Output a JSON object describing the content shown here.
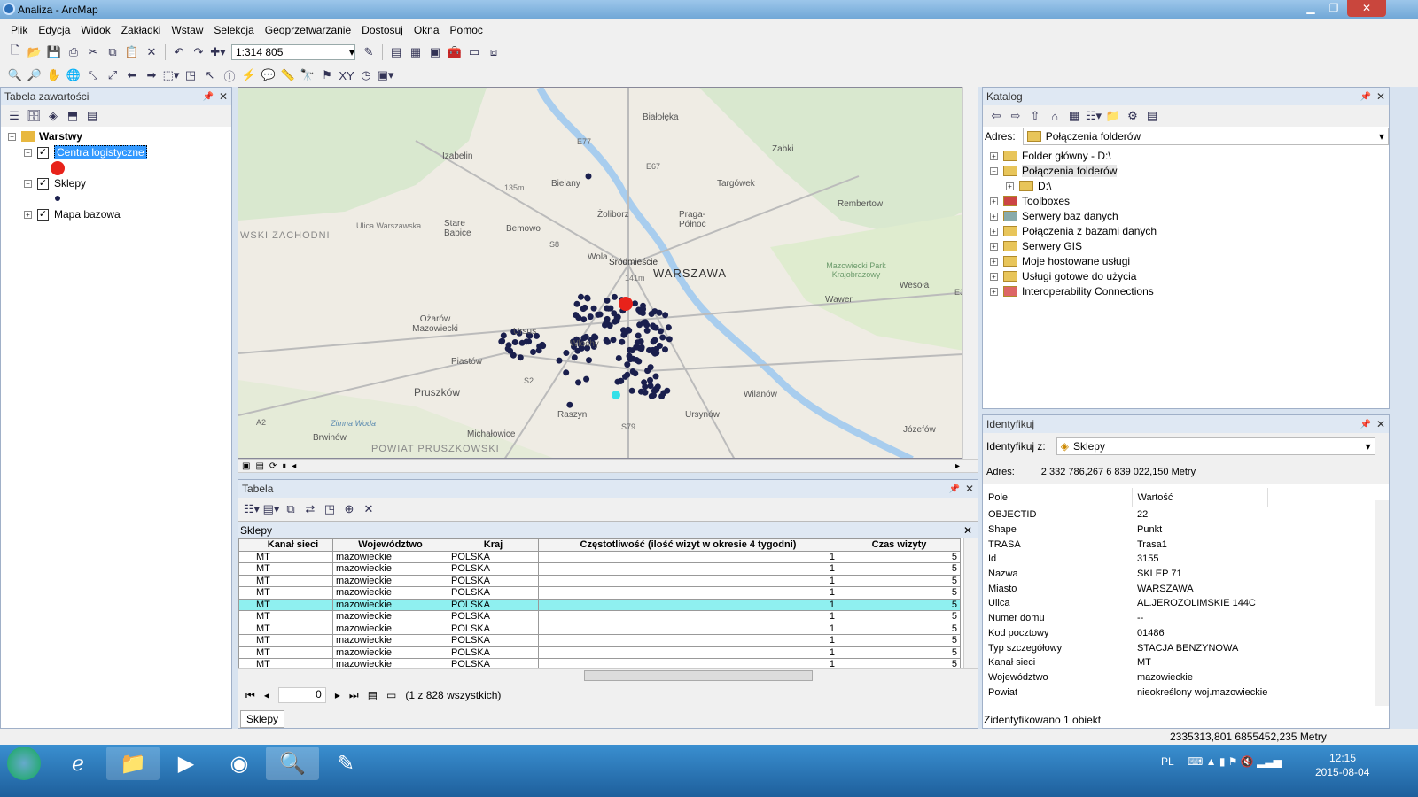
{
  "window": {
    "title": "Analiza - ArcMap"
  },
  "menu": [
    "Plik",
    "Edycja",
    "Widok",
    "Zakładki",
    "Wstaw",
    "Selekcja",
    "Geoprzetwarzanie",
    "Dostosuj",
    "Okna",
    "Pomoc"
  ],
  "toolbar": {
    "scale": "1:314 805"
  },
  "toc": {
    "title": "Tabela zawartości",
    "root": "Warstwy",
    "layers": [
      "Centra logistyczne",
      "Sklepy",
      "Mapa bazowa"
    ]
  },
  "map": {
    "places": [
      "Białołęka",
      "Izabelin",
      "Bielany",
      "Zabki",
      "Targówek",
      "Żoliborz",
      "Praga-Północ",
      "Rembertow",
      "Bemowo",
      "Stare Babice",
      "WSKI ZACHODNI",
      "Ulica Warszawska",
      "Wola",
      "Śródmieście",
      "WARSZAWA",
      "Mazowiecki Park Krajobrazowy",
      "Wesoła",
      "Ożarów Mazowiecki",
      "Ursus",
      "Włochy",
      "Wawer",
      "Piastów",
      "Pruszków",
      "Raszyn",
      "Wilanów",
      "Ursynów",
      "Michałowice",
      "Brwinów",
      "POWIAT PRUSZKOWSKI",
      "Józefów",
      "135m",
      "141m",
      "E77",
      "E30",
      "S8",
      "S79",
      "E67",
      "S2",
      "A2",
      "Zimna Woda"
    ],
    "colors": {
      "shop": "#1a1f4d",
      "center": "#e8221a",
      "selected": "#33e0e8"
    }
  },
  "catalog": {
    "title": "Katalog",
    "address_label": "Adres:",
    "address_value": "Połączenia folderów",
    "items": [
      "Folder główny - D:\\",
      "Połączenia folderów",
      "D:\\",
      "Toolboxes",
      "Serwery baz danych",
      "Połączenia z bazami danych",
      "Serwery GIS",
      "Moje hostowane usługi",
      "Usługi gotowe do użycia",
      "Interoperability Connections"
    ]
  },
  "identify": {
    "title": "Identyfikuj",
    "from_label": "Identyfikuj z:",
    "from_value": "Sklepy",
    "address_label": "Adres:",
    "address_value": "2 332 786,267  6 839 022,150 Metry",
    "col_field": "Pole",
    "col_value": "Wartość",
    "rows": [
      {
        "f": "OBJECTID",
        "v": "22"
      },
      {
        "f": "Shape",
        "v": "Punkt"
      },
      {
        "f": "TRASA",
        "v": "Trasa1"
      },
      {
        "f": "Id",
        "v": "3155"
      },
      {
        "f": "Nazwa",
        "v": "SKLEP 71"
      },
      {
        "f": "Miasto",
        "v": "WARSZAWA"
      },
      {
        "f": "Ulica",
        "v": "AL.JEROZOLIMSKIE 144C"
      },
      {
        "f": "Numer domu",
        "v": "--"
      },
      {
        "f": "Kod pocztowy",
        "v": "01486"
      },
      {
        "f": "Typ szczegółowy",
        "v": "STACJA BENZYNOWA"
      },
      {
        "f": "Kanał sieci",
        "v": "MT"
      },
      {
        "f": "Województwo",
        "v": "mazowieckie"
      },
      {
        "f": "Powiat",
        "v": "nieokreślony woj.mazowieckie"
      }
    ],
    "status": "Zidentyfikowano 1 obiekt"
  },
  "table": {
    "title": "Tabela",
    "layer": "Sklepy",
    "columns": [
      "Kanał sieci",
      "Województwo",
      "Kraj",
      "Częstotliwość (ilość wizyt w okresie 4 tygodni)",
      "Czas wizyty"
    ],
    "rows": [
      [
        "MT",
        "mazowieckie",
        "POLSKA",
        "1",
        "5"
      ],
      [
        "MT",
        "mazowieckie",
        "POLSKA",
        "1",
        "5"
      ],
      [
        "MT",
        "mazowieckie",
        "POLSKA",
        "1",
        "5"
      ],
      [
        "MT",
        "mazowieckie",
        "POLSKA",
        "1",
        "5"
      ],
      [
        "MT",
        "mazowieckie",
        "POLSKA",
        "1",
        "5"
      ],
      [
        "MT",
        "mazowieckie",
        "POLSKA",
        "1",
        "5"
      ],
      [
        "MT",
        "mazowieckie",
        "POLSKA",
        "1",
        "5"
      ],
      [
        "MT",
        "mazowieckie",
        "POLSKA",
        "1",
        "5"
      ],
      [
        "MT",
        "mazowieckie",
        "POLSKA",
        "1",
        "5"
      ],
      [
        "MT",
        "mazowieckie",
        "POLSKA",
        "1",
        "5"
      ]
    ],
    "record": "0",
    "count": "(1 z 828 wszystkich)",
    "tab": "Sklepy"
  },
  "statusbar": {
    "coords": "2335313,801  6855452,235 Metry"
  },
  "taskbar": {
    "lang": "PL",
    "time": "12:15",
    "date": "2015-08-04"
  }
}
